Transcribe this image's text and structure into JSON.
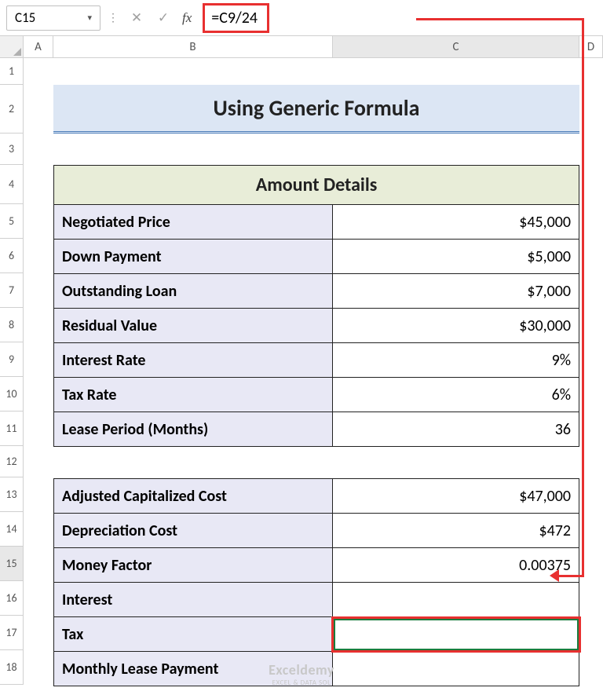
{
  "formula_bar": {
    "active_cell": "C15",
    "formula": "=C9/24"
  },
  "columns": {
    "A": "A",
    "B": "B",
    "C": "C",
    "D": "D"
  },
  "rows": [
    "1",
    "2",
    "3",
    "4",
    "5",
    "6",
    "7",
    "8",
    "9",
    "10",
    "11",
    "12",
    "13",
    "14",
    "15",
    "16",
    "17",
    "18"
  ],
  "title": "Using Generic Formula",
  "section1_header": "Amount Details",
  "section1": [
    {
      "label": "Negotiated Price",
      "value": "$45,000"
    },
    {
      "label": "Down Payment",
      "value": "$5,000"
    },
    {
      "label": "Outstanding Loan",
      "value": "$7,000"
    },
    {
      "label": "Residual Value",
      "value": "$30,000"
    },
    {
      "label": "Interest Rate",
      "value": "9%"
    },
    {
      "label": "Tax Rate",
      "value": "6%"
    },
    {
      "label": "Lease Period (Months)",
      "value": "36"
    }
  ],
  "section2": [
    {
      "label": "Adjusted Capitalized Cost",
      "value": "$47,000"
    },
    {
      "label": "Depreciation Cost",
      "value": "$472"
    },
    {
      "label": "Money Factor",
      "value": "0.00375"
    },
    {
      "label": "Interest",
      "value": ""
    },
    {
      "label": "Tax",
      "value": ""
    },
    {
      "label": "Monthly Lease Payment",
      "value": ""
    }
  ],
  "watermark": {
    "main": "Exceldemy",
    "sub": "EXCEL & DATA SOL"
  }
}
